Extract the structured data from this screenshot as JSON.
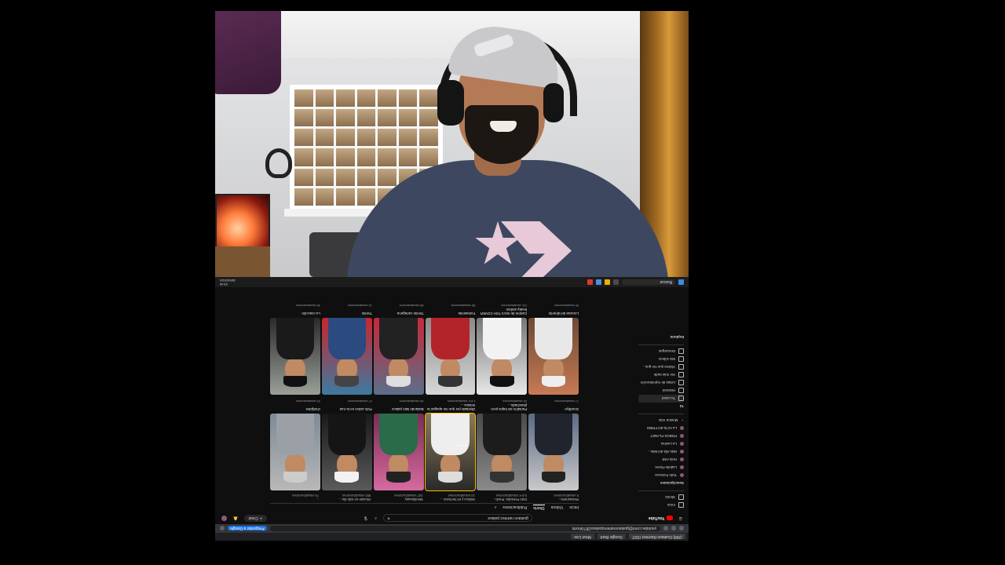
{
  "browser": {
    "tabs": [
      {
        "label": "(268) Gustavo Ramirez ISST"
      },
      {
        "label": "Google Bard"
      },
      {
        "label": "Meet Live"
      }
    ],
    "url": "youtube.com/@gustavoramirezpalace287/shorts",
    "gemini_label": "Preguntar a Google"
  },
  "youtube": {
    "logo": "YouTube",
    "search_value": "gustavo ramirez palace",
    "create_label": "Crear",
    "channel_tabs": [
      "Inicio",
      "Vídeos",
      "Shorts",
      "Publicaciones"
    ],
    "active_tab": "Shorts",
    "sidebar": {
      "main": [
        {
          "label": "Inicio",
          "icon": "home-icon"
        },
        {
          "label": "Shorts",
          "icon": "shorts-icon"
        }
      ],
      "subs_header": "Suscripciones",
      "subscriptions": [
        "Todo Fonseca",
        "Ladelle Flores",
        "Hola ASE",
        "Más Allá del Más...",
        "La Lavinia",
        "POBOS PLANET",
        "La ACTa del FRIBO"
      ],
      "show_more": "Mostrar más",
      "you_header": "Tú",
      "you_items": [
        {
          "label": "Tu canal",
          "icon": "user-icon"
        },
        {
          "label": "Historial",
          "icon": "history-icon"
        },
        {
          "label": "Listas de reproducción",
          "icon": "playlist-icon"
        },
        {
          "label": "Ver más tarde",
          "icon": "clock-icon"
        },
        {
          "label": "Vídeos que me gus...",
          "icon": "like-icon"
        },
        {
          "label": "Mis vídeos",
          "icon": "video-icon"
        },
        {
          "label": "Descargas",
          "icon": "download-icon"
        }
      ],
      "explore_header": "Explorar"
    },
    "top_row": [
      {
        "title": "Restaurante...",
        "views": "5 visualizaciones"
      },
      {
        "title": "Esto Pensaba: Prueb...",
        "views": "5,5 K visualizaciones"
      },
      {
        "title": "Música y mi hermano ...",
        "views": "24 visualizaciones"
      },
      {
        "title": "Mundiaaaay",
        "views": "347 visualizaciones"
      },
      {
        "title": "Alicante en solo dia ...",
        "views": "892 visualizaciones"
      },
      {
        "title": "...",
        "views": "76 visualizaciones"
      }
    ],
    "shorts_row1": [
      {
        "title": "Goodbye",
        "views": "17 visualizaciones"
      },
      {
        "title": "Pantalón sin bajos pero planchado...",
        "views": "25 visualizaciones"
      },
      {
        "title": "Olvidado por que me apagan la música ...",
        "views": "1,6 K visualizaciones"
      },
      {
        "title": "Bailando latin palace",
        "views": "46 visualizaciones"
      },
      {
        "title": "Pido activo en la ruut",
        "views": "47 visualizaciones"
      },
      {
        "title": "chotijides",
        "views": "24 visualizaciones"
      }
    ],
    "shorts_row2": [
      {
        "title": "Locuras del dinerito",
        "views": "25 visualizaciones"
      },
      {
        "title": "Cartmé de micro TDH COVER freaky ambos",
        "views": "211 visualizaciones"
      },
      {
        "title": "Fantasmita",
        "views": "88 visualizaciones"
      },
      {
        "title": "Tomito cartagena",
        "views": "68 visualizaciones"
      },
      {
        "title": "Tomito",
        "views": "21 visualizaciones"
      },
      {
        "title": "La coacción",
        "views": "36 visualizaciones"
      }
    ],
    "overlay_time": "5:00 AM"
  },
  "taskbar": {
    "search_label": "Buscar",
    "time": "23:46",
    "date": "18/04/2024"
  }
}
